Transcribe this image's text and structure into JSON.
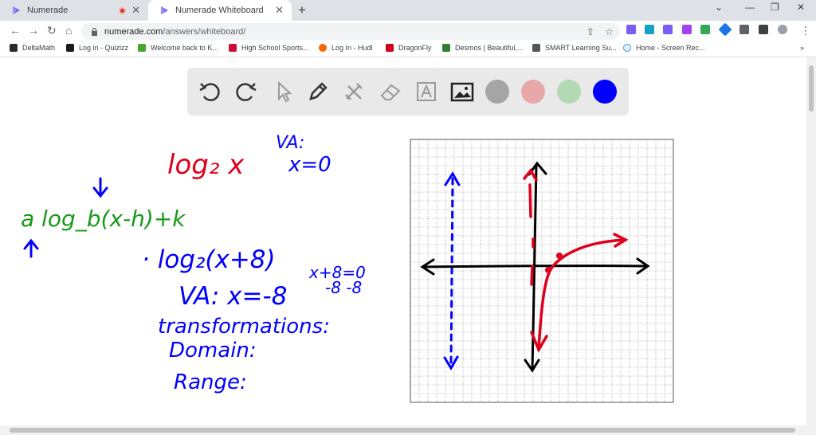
{
  "browser": {
    "tabs": [
      {
        "title": "Numerade",
        "recording": true
      },
      {
        "title": "Numerade Whiteboard",
        "active": true
      }
    ],
    "url_host": "numerade.com",
    "url_path": "/answers/whiteboard/",
    "bookmarks": [
      "DeltaMath",
      "Log in - Quizizz",
      "Welcome back to K...",
      "High School Sports...",
      "Log In - Hudl",
      "DragonFly",
      "Desmos | Beautiful,...",
      "SMART Learning Su...",
      "Home - Screen Rec..."
    ],
    "overflow": "»"
  },
  "toolbar": {
    "tools": [
      "undo-icon",
      "redo-icon",
      "select-pointer-icon",
      "pen-icon",
      "tools-icon",
      "eraser-icon",
      "text-icon",
      "image-icon"
    ],
    "colors": [
      "#a5a5a5",
      "#e8a8a8",
      "#b3d9b3",
      "#0000ff"
    ]
  },
  "whiteboard": {
    "notes": [
      {
        "text": "log₂ x",
        "color": "#e0001b"
      },
      {
        "text": "VA:",
        "color": "#0000ff"
      },
      {
        "text": "x=0",
        "color": "#0000ff"
      },
      {
        "text": "a log_b(x-h)+k",
        "color": "#1a9a1a"
      },
      {
        "text": "· log₂(x+8)",
        "color": "#0000ff"
      },
      {
        "text": "VA: x=-8",
        "color": "#0000ff"
      },
      {
        "text": "x+8=0",
        "color": "#0000ff"
      },
      {
        "text": "-8 -8",
        "color": "#0000ff"
      },
      {
        "text": "transformations:",
        "color": "#0000ff"
      },
      {
        "text": "Domain:",
        "color": "#0000ff"
      },
      {
        "text": "Range:",
        "color": "#0000ff"
      }
    ]
  }
}
